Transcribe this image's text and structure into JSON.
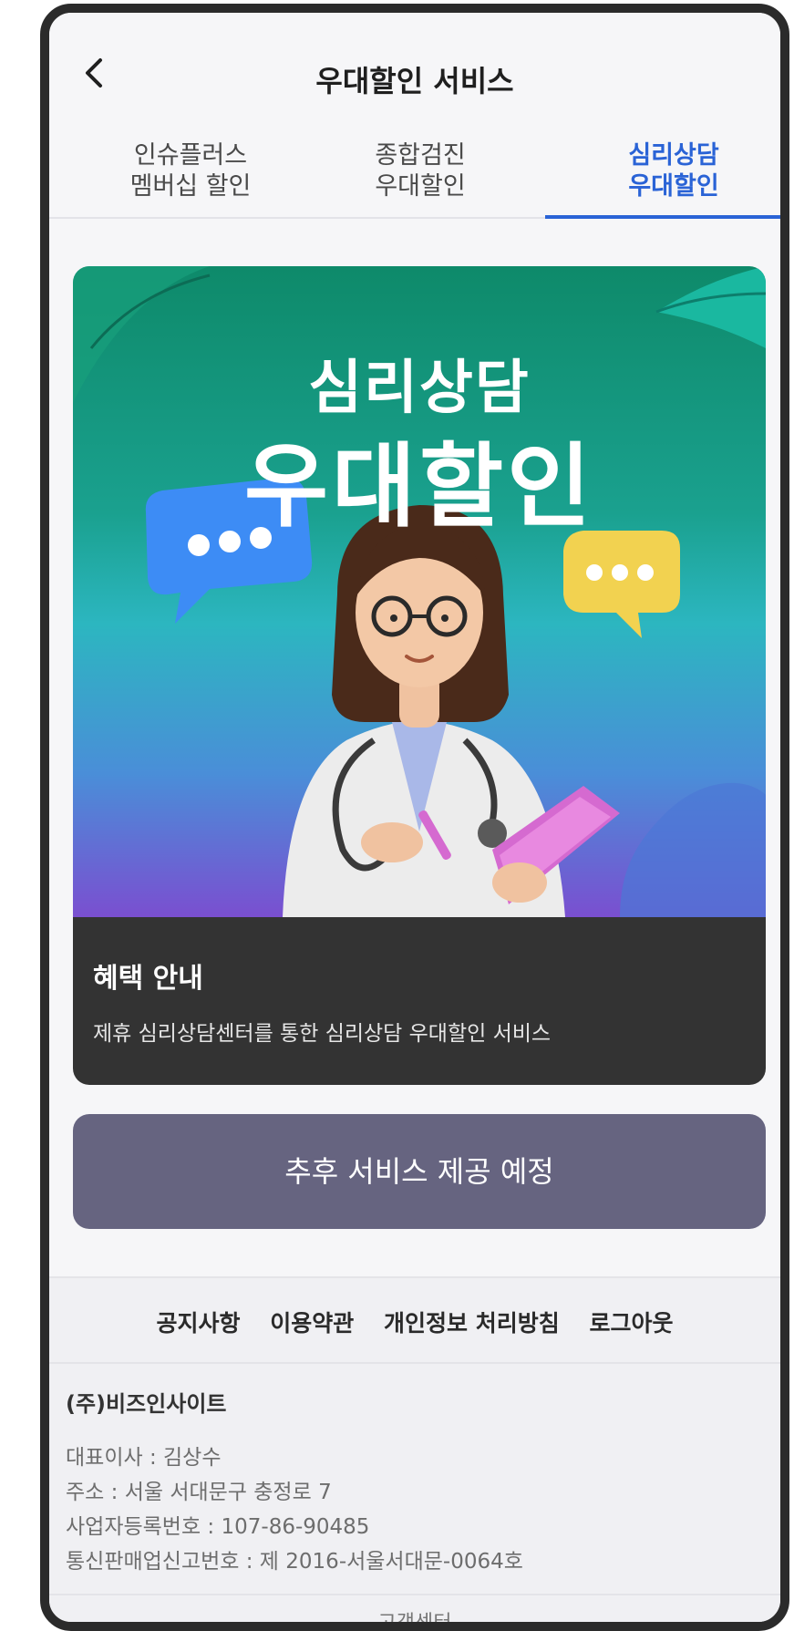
{
  "header": {
    "title": "우대할인 서비스",
    "back_icon": "chevron-left-icon"
  },
  "tabs": [
    {
      "label": "인슈플러스\n멤버십 할인",
      "active": false
    },
    {
      "label": "종합검진\n우대할인",
      "active": false
    },
    {
      "label": "심리상담\n우대할인",
      "active": true
    }
  ],
  "banner": {
    "title_line1": "심리상담",
    "title_line2": "우대할인"
  },
  "benefit": {
    "title": "혜택 안내",
    "description": "제휴 심리상담센터를 통한 심리상담 우대할인 서비스"
  },
  "cta": {
    "label": "추후 서비스 제공 예정"
  },
  "footer": {
    "links": [
      "공지사항",
      "이용약관",
      "개인정보 처리방침",
      "로그아웃"
    ],
    "company_name": "(주)비즈인사이트",
    "ceo": "대표이사 : 김상수",
    "address": "주소 : 서울 서대문구 충정로 7",
    "business_number": "사업자등록번호 : 107-86-90485",
    "mail_order_number": "통신판매업신고번호 : 제 2016-서울서대문-0064호",
    "customer_center": "고객센터"
  },
  "colors": {
    "accent": "#2a63d6",
    "cta_bg": "#666480",
    "info_bg": "#333333"
  }
}
